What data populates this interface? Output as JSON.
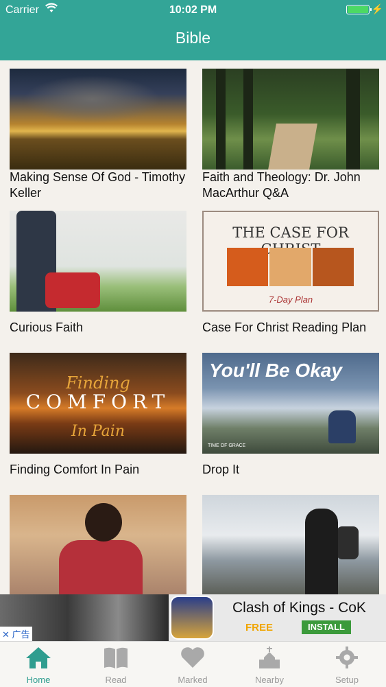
{
  "status_bar": {
    "carrier": "Carrier",
    "time": "10:02 PM"
  },
  "header": {
    "title": "Bible"
  },
  "plans": [
    {
      "title": "Making Sense Of God - Timothy Keller"
    },
    {
      "title": "Faith and Theology: Dr. John MacArthur Q&A"
    },
    {
      "title": "Curious Faith"
    },
    {
      "title": "Case For Christ Reading Plan"
    },
    {
      "title": "Finding Comfort In Pain"
    },
    {
      "title": "Drop It"
    }
  ],
  "thumb_text": {
    "case_for_christ": {
      "title": "THE CASE FOR CHRIST",
      "subtitle": "7-Day Plan"
    },
    "finding_comfort": {
      "line1": "Finding",
      "line2": "COMFORT",
      "line3": "In Pain"
    },
    "youll_be_okay": {
      "text": "You'll Be Okay",
      "brand": "TIME OF GRACE"
    }
  },
  "ad": {
    "app_name": "Clash of Kings - CoK",
    "price": "FREE",
    "cta": "INSTALL",
    "tag": "✕ 广告"
  },
  "tabbar": {
    "tabs": [
      {
        "label": "Home",
        "icon": "home-icon"
      },
      {
        "label": "Read",
        "icon": "book-icon"
      },
      {
        "label": "Marked",
        "icon": "heart-icon"
      },
      {
        "label": "Nearby",
        "icon": "church-icon"
      },
      {
        "label": "Setup",
        "icon": "gear-icon"
      }
    ],
    "active": "Home"
  },
  "colors": {
    "accent": "#33a597",
    "tab_active": "#2f9d8f",
    "tab_inactive": "#9b9b9b"
  }
}
